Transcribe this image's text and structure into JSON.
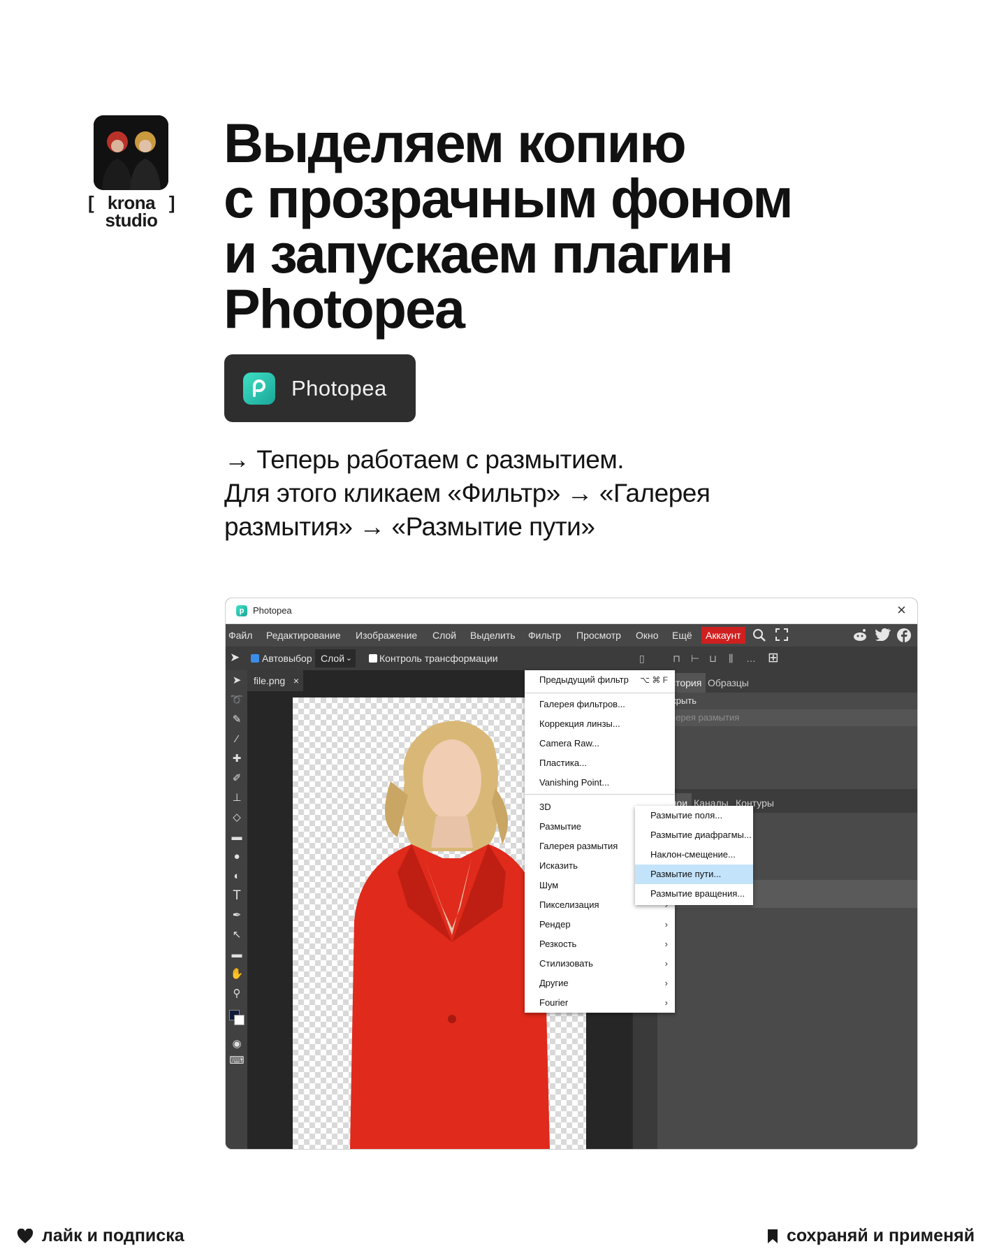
{
  "brand": {
    "line1_open": "[",
    "line1_name": "krona",
    "line1_close": "]",
    "line2": "studio"
  },
  "headline": [
    "Выделяем копию",
    "с прозрачным фоном",
    "и запускаем плагин",
    "Photopea"
  ],
  "app_badge": {
    "label": "Photopea"
  },
  "instructions": [
    "→ Теперь работаем с размытием.",
    "Для этого кликаем «Фильтр» → «Галерея",
    "размытия» → «Размытие пути»"
  ],
  "photopea": {
    "window_title": "Photopea",
    "menubar": [
      "Файл",
      "Редактирование",
      "Изображение",
      "Слой",
      "Выделить",
      "Фильтр",
      "Просмотр",
      "Окно",
      "Ещё"
    ],
    "account_label": "Аккаунт",
    "options": {
      "autoselect_label": "Автовыбор",
      "layer_select_value": "Слой",
      "transform_controls_label": "Контроль трансформации"
    },
    "doc_tab": "file.png",
    "filter_menu": {
      "last_filter": "Предыдущий фильтр",
      "last_filter_shortcut": "⌥ ⌘ F",
      "group1": [
        "Галерея фильтров...",
        "Коррекция линзы...",
        "Camera Raw...",
        "Пластика...",
        "Vanishing Point..."
      ],
      "group2": [
        "3D",
        "Размытие",
        "Галерея размытия",
        "Исказить",
        "Шум",
        "Пикселизация",
        "Рендер",
        "Резкость",
        "Стилизовать",
        "Другие",
        "Fourier"
      ]
    },
    "blur_gallery_submenu": [
      "Размытие поля...",
      "Размытие диафрагмы...",
      "Наклон-смещение...",
      "Размытие пути...",
      "Размытие вращения..."
    ],
    "highlighted_submenu_item": "Размытие пути...",
    "history_panel": {
      "tabs": [
        "История",
        "Образцы"
      ],
      "items": [
        "Открыть",
        "Галерея размытия"
      ]
    },
    "layers_panel": {
      "tabs": [
        "Слои",
        "Каналы",
        "Контуры"
      ]
    },
    "colors": {
      "account": "#cf1f1f",
      "highlight": "#c3e3fb",
      "jacket": "#e02a1c"
    }
  },
  "footer": {
    "left_label": "лайк и подписка",
    "right_label": "сохраняй и применяй"
  }
}
